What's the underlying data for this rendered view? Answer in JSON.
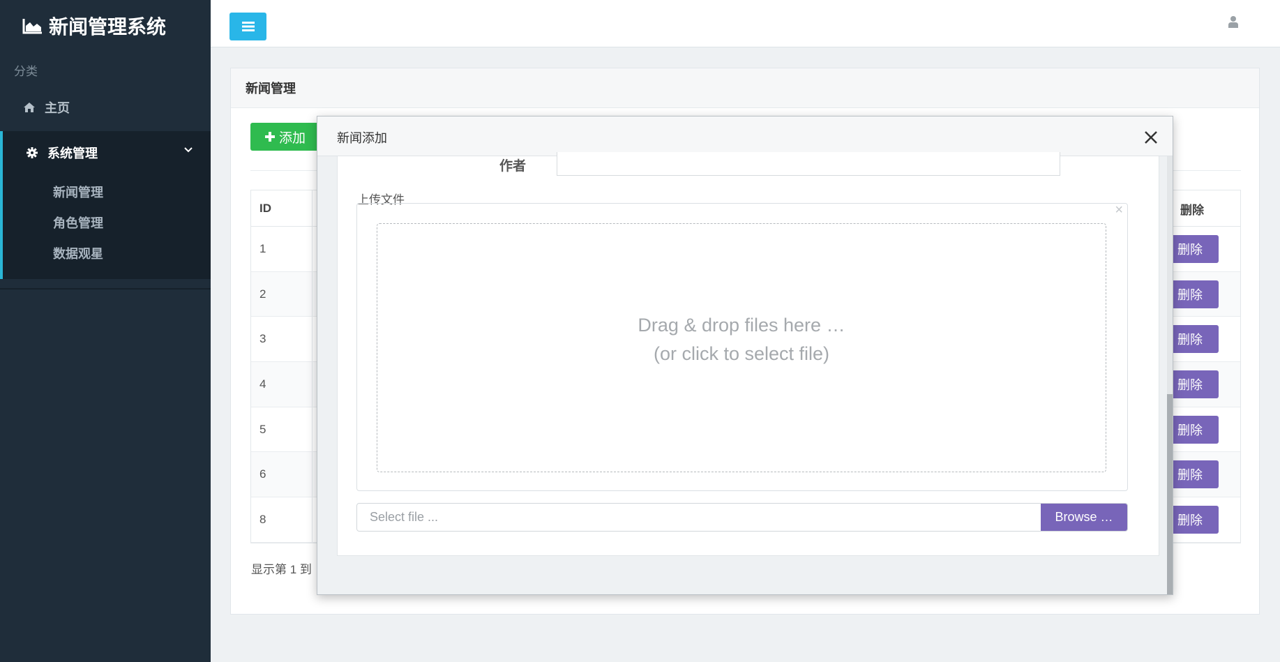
{
  "brand": {
    "title": "新闻管理系统"
  },
  "sidebar": {
    "category_label": "分类",
    "home_label": "主页",
    "group_label": "系统管理",
    "items": [
      {
        "label": "新闻管理"
      },
      {
        "label": "角色管理"
      },
      {
        "label": "数据观星"
      }
    ]
  },
  "main": {
    "box_title": "新闻管理",
    "add_label": "添加",
    "table": {
      "headers": {
        "id": "ID",
        "delete": "删除"
      },
      "rows": [
        {
          "id": "1",
          "delete": "删除"
        },
        {
          "id": "2",
          "delete": "删除"
        },
        {
          "id": "3",
          "delete": "删除"
        },
        {
          "id": "4",
          "delete": "删除"
        },
        {
          "id": "5",
          "delete": "删除"
        },
        {
          "id": "6",
          "delete": "删除"
        },
        {
          "id": "8",
          "delete": "删除"
        }
      ]
    },
    "footer_text": "显示第 1 到"
  },
  "modal": {
    "title": "新闻添加",
    "author_label": "作者",
    "upload_label": "上传文件",
    "dropzone_line1": "Drag & drop files here …",
    "dropzone_line2": "(or click to select file)",
    "file_placeholder": "Select file ...",
    "browse_label": "Browse …"
  },
  "colors": {
    "sidebar_bg": "#1f2d3a",
    "accent": "#29b6e8",
    "success": "#2fbb4f",
    "purple": "#7865b9"
  },
  "icons": [
    "area-chart-icon",
    "home-icon",
    "gear-icon",
    "chevron-down-icon",
    "bars-icon",
    "user-icon",
    "plus-icon",
    "close-icon"
  ]
}
